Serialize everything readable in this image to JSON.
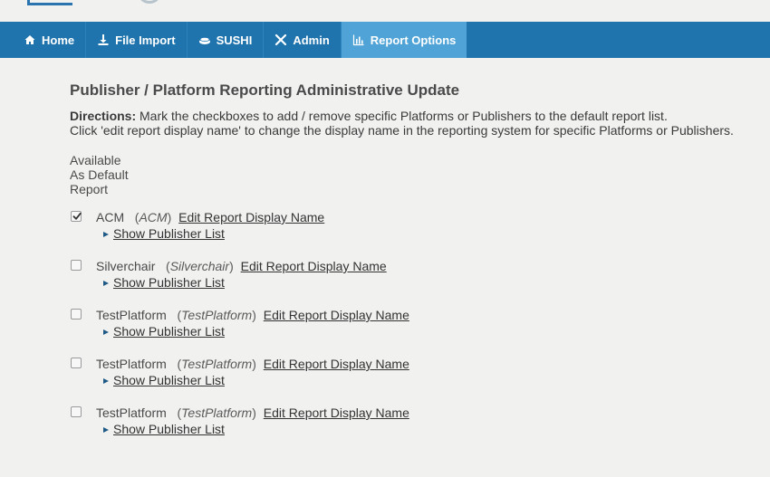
{
  "colors": {
    "navbar": "#1f74ae",
    "nav_active": "#4fa3d6",
    "background": "#f1f1f0"
  },
  "nav": {
    "items": [
      {
        "label": "Home",
        "icon": "home-icon"
      },
      {
        "label": "File Import",
        "icon": "download-icon"
      },
      {
        "label": "SUSHI",
        "icon": "sushi-icon"
      },
      {
        "label": "Admin",
        "icon": "tools-icon"
      },
      {
        "label": "Report Options",
        "icon": "bar-chart-icon",
        "active": true
      }
    ]
  },
  "page": {
    "title": "Publisher / Platform Reporting Administrative Update",
    "directions_label": "Directions:",
    "directions_line1": " Mark the checkboxes to add / remove specific Platforms or Publishers to the default report list.",
    "directions_line2": "Click 'edit report display name' to change the display name in the reporting system for specific Platforms or Publishers.",
    "column_head": [
      "Available",
      "As Default",
      "Report"
    ]
  },
  "platforms": [
    {
      "name": "ACM",
      "alt": "ACM",
      "checked": true,
      "edit_label": "Edit Report Display Name",
      "show_label": "Show Publisher List"
    },
    {
      "name": "Silverchair",
      "alt": "Silverchair",
      "checked": false,
      "edit_label": "Edit Report Display Name",
      "show_label": "Show Publisher List"
    },
    {
      "name": "TestPlatform",
      "alt": "TestPlatform",
      "checked": false,
      "edit_label": "Edit Report Display Name",
      "show_label": "Show Publisher List"
    },
    {
      "name": "TestPlatform",
      "alt": "TestPlatform",
      "checked": false,
      "edit_label": "Edit Report Display Name",
      "show_label": "Show Publisher List"
    },
    {
      "name": "TestPlatform",
      "alt": "TestPlatform",
      "checked": false,
      "edit_label": "Edit Report Display Name",
      "show_label": "Show Publisher List"
    }
  ]
}
